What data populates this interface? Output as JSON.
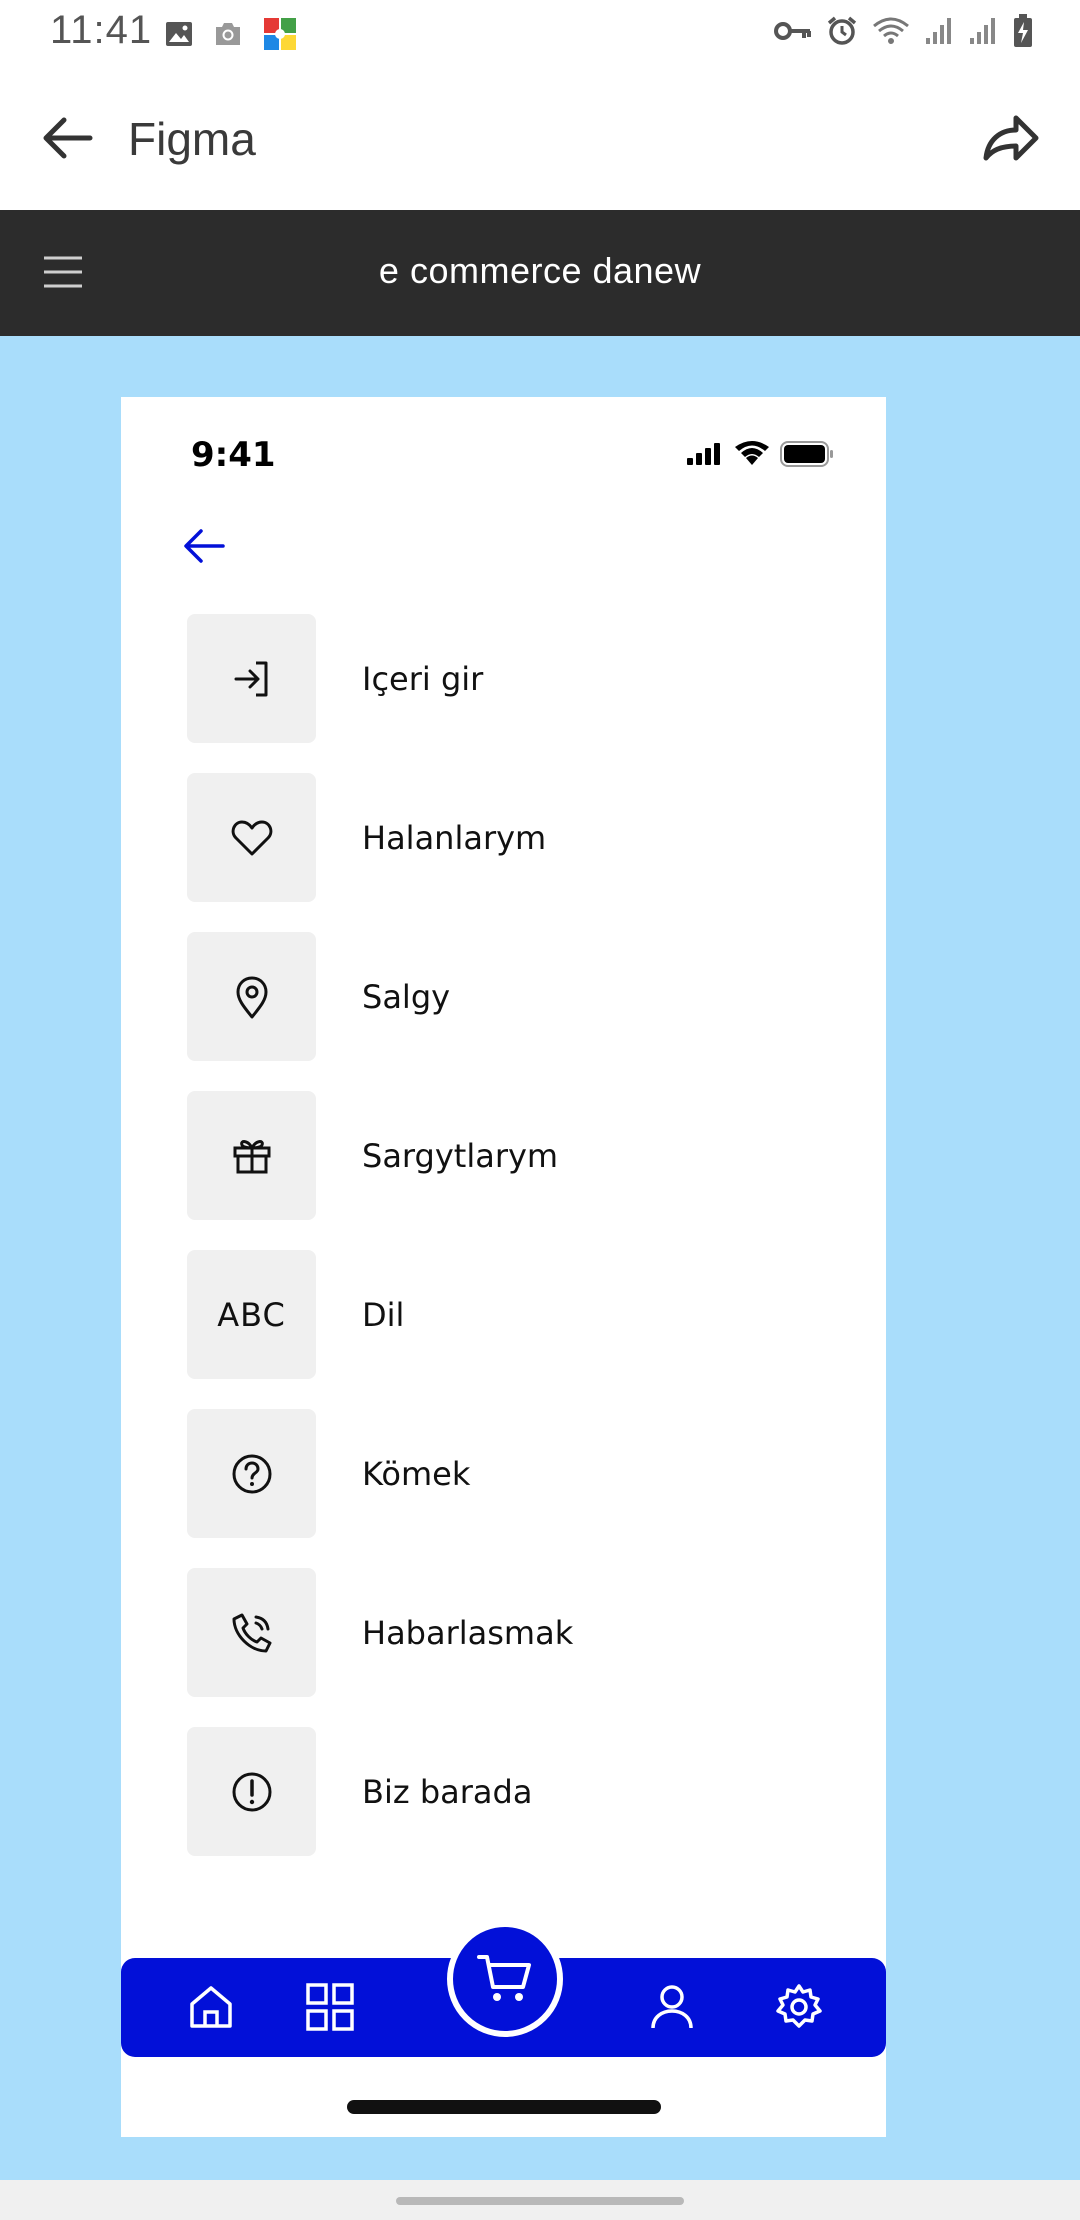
{
  "status_bar": {
    "time": "11:41",
    "left_icons": [
      "image-icon",
      "camera-icon",
      "puzzle-app-icon"
    ],
    "right_icons": [
      "key-icon",
      "alarm-icon",
      "wifi-icon",
      "signal-icon",
      "signal-icon",
      "battery-charging-icon"
    ]
  },
  "app_bar": {
    "title": "Figma",
    "back_icon": "arrow-left-icon",
    "share_icon": "share-icon"
  },
  "file_bar": {
    "title": "e commerce danew",
    "menu_icon": "hamburger-icon"
  },
  "frame": {
    "time": "9:41",
    "status_icons": [
      "cellular-icon",
      "wifi-icon",
      "battery-icon"
    ],
    "back_icon": "arrow-left-icon",
    "accent_color": "#0210d8",
    "menu": [
      {
        "icon": "login-icon",
        "label": "Içeri gir"
      },
      {
        "icon": "heart-icon",
        "label": "Halanlarym"
      },
      {
        "icon": "location-pin-icon",
        "label": "Salgy"
      },
      {
        "icon": "gift-icon",
        "label": "Sargytlarym"
      },
      {
        "icon": "abc-icon",
        "icon_text": "ABC",
        "label": "Dil"
      },
      {
        "icon": "help-circle-icon",
        "label": "Kömek"
      },
      {
        "icon": "phone-icon",
        "label": "Habarlasmak"
      },
      {
        "icon": "info-circle-icon",
        "label": "Biz barada"
      }
    ],
    "tab_bar": [
      "home-icon",
      "grid-icon",
      "cart-icon",
      "user-icon",
      "settings-icon"
    ]
  },
  "colors": {
    "canvas_bg": "#a9ddfb",
    "file_bar_bg": "#2c2c2c",
    "icon_box_bg": "#f0f0f0"
  }
}
